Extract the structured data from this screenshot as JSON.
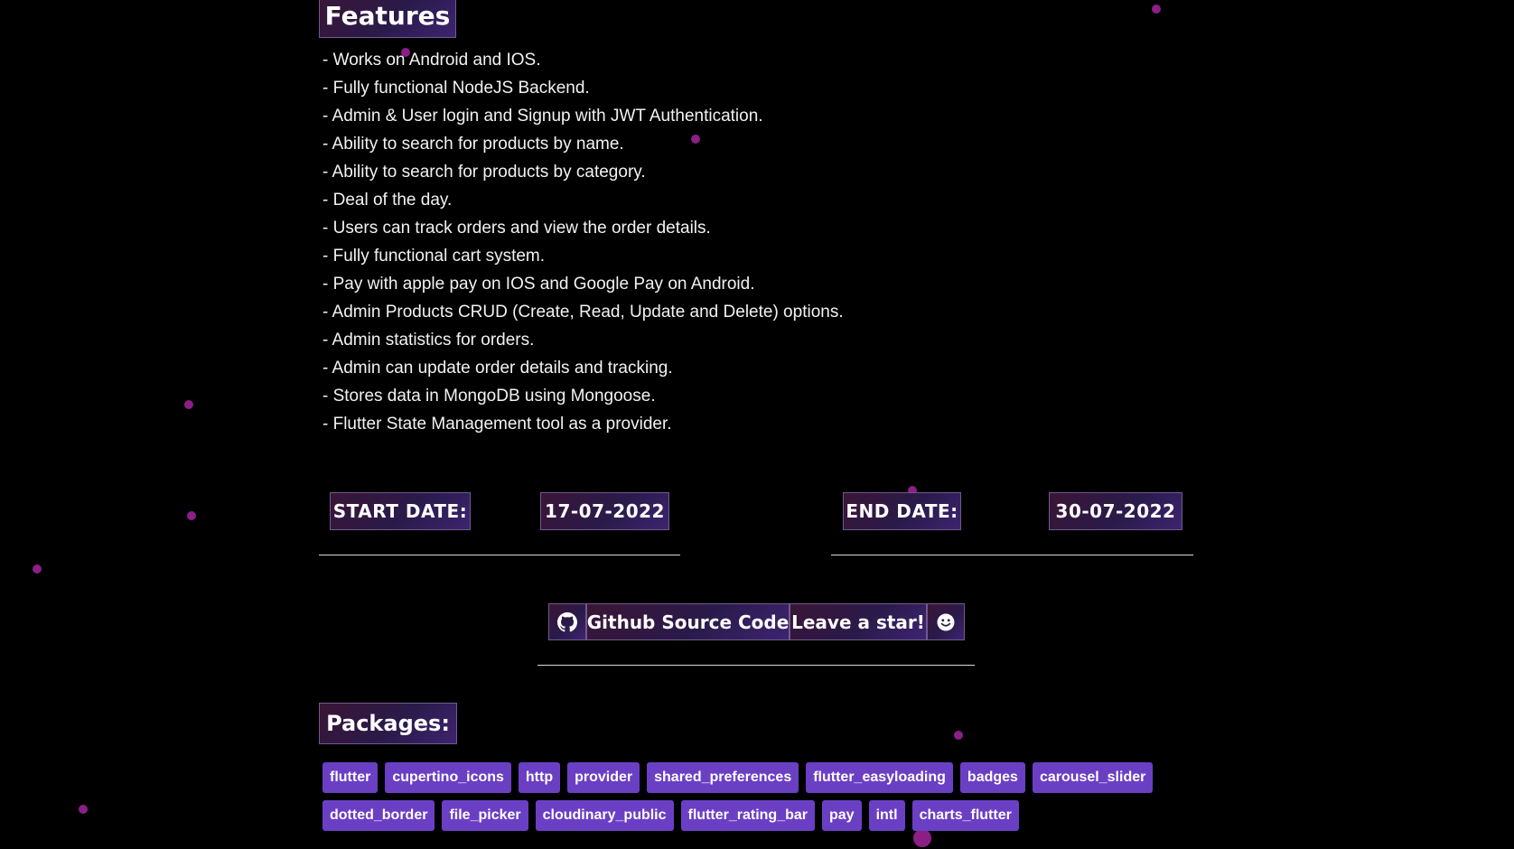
{
  "features": {
    "title": "Features",
    "items": [
      "- Works on Android and IOS.",
      "- Fully functional NodeJS Backend.",
      "- Admin & User login and Signup with JWT Authentication.",
      "- Ability to search for products by name.",
      "- Ability to search for products by category.",
      "- Deal of the day.",
      "- Users can track orders and view the order details.",
      "- Fully functional cart system.",
      "- Pay with apple pay on IOS and Google Pay on Android.",
      "- Admin Products CRUD (Create, Read, Update and Delete) options.",
      "- Admin statistics for orders.",
      "- Admin can update order details and tracking.",
      "- Stores data in MongoDB using Mongoose.",
      "- Flutter State Management tool as a provider."
    ]
  },
  "dates": {
    "start_label": "START DATE:",
    "start_value": "17-07-2022",
    "end_label": "END DATE:",
    "end_value": "30-07-2022"
  },
  "github": {
    "icon": "github-icon",
    "source_label": "Github Source Code",
    "star_label": "Leave a star!",
    "smile_icon": "smile-icon"
  },
  "packages": {
    "title": "Packages:",
    "row1": [
      "flutter",
      "cupertino_icons",
      "http",
      "provider",
      "shared_preferences",
      "flutter_easyloading",
      "badges",
      "carousel_slider"
    ],
    "row2": [
      "dotted_border",
      "file_picker",
      "cloudinary_public",
      "flutter_rating_bar",
      "pay",
      "intl",
      "charts_flutter"
    ]
  },
  "colors": {
    "background": "#000000",
    "accent_gradient_start": "#3a1535",
    "accent_gradient_end": "#3d2470",
    "badge": "#6a3fc4",
    "particle": "#8a1f86"
  }
}
